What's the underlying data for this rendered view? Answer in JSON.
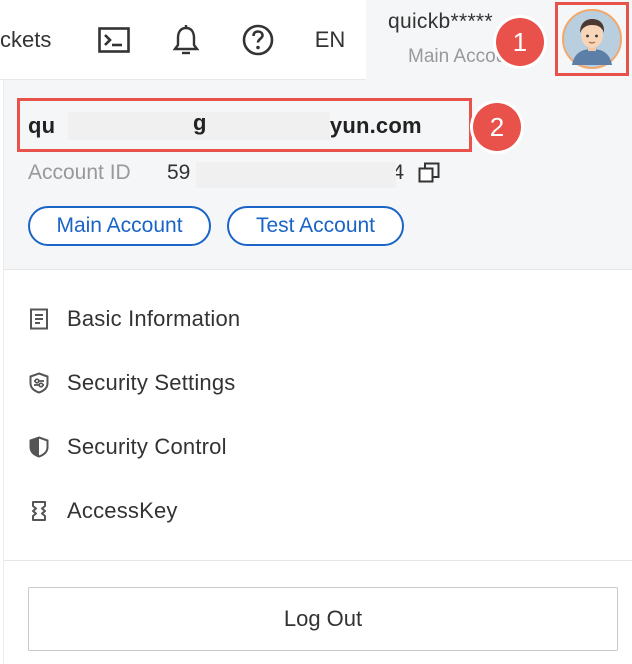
{
  "topbar": {
    "tickets_label": "ckets",
    "lang_label": "EN",
    "account_name": "quickb*****",
    "account_role": "Main Account",
    "icons": [
      "terminal-icon",
      "bell-icon",
      "help-icon",
      "avatar"
    ]
  },
  "callouts": {
    "one": "1",
    "two": "2"
  },
  "profile": {
    "email_visible_start": "qu",
    "email_visible_mid": "g",
    "email_visible_end": "liyun.com",
    "account_id_label": "Account ID",
    "account_id_start": "59",
    "account_id_end": "4",
    "tags": [
      "Main Account",
      "Test Account"
    ]
  },
  "menu": {
    "items": [
      {
        "label": "Basic Information",
        "icon": "document-icon"
      },
      {
        "label": "Security Settings",
        "icon": "shield-settings-icon"
      },
      {
        "label": "Security Control",
        "icon": "shield-icon"
      },
      {
        "label": "AccessKey",
        "icon": "key-icon"
      }
    ]
  },
  "logout_label": "Log Out",
  "colors": {
    "accent": "#e8524a",
    "link": "#1a64c8",
    "panel": "#f5f6f7"
  }
}
